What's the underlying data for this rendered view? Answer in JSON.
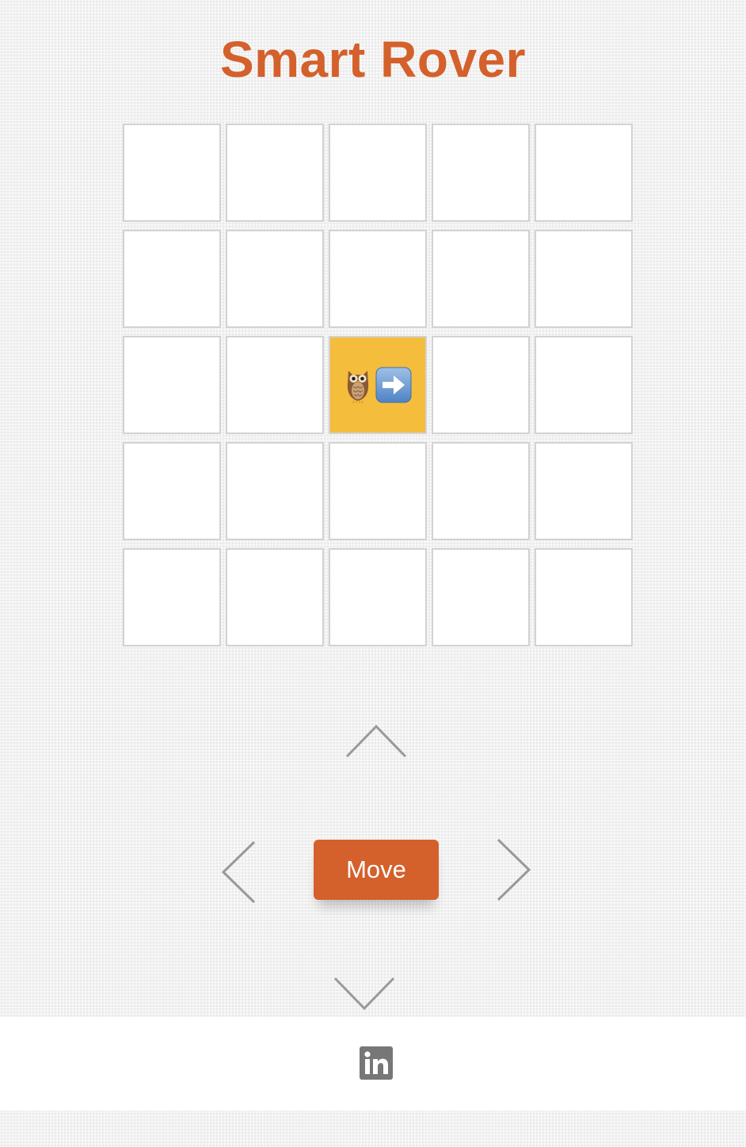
{
  "header": {
    "title": "Smart Rover"
  },
  "board": {
    "rows": 5,
    "columns": 5,
    "rover": {
      "row": 2,
      "column": 2,
      "direction": "right",
      "icons": [
        "owl-icon",
        "right-arrow-icon"
      ]
    },
    "colors": {
      "cell": "#ffffff",
      "cell_border": "#d2d2d2",
      "active_cell": "#f4bd3b"
    }
  },
  "controls": {
    "move_label": "Move",
    "arrows": [
      "up",
      "left",
      "right",
      "down"
    ],
    "accent": "#d4602b"
  },
  "footer": {
    "social": [
      "linkedin-icon"
    ]
  }
}
